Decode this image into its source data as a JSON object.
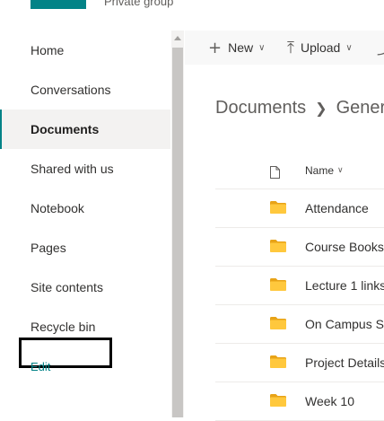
{
  "header": {
    "subtitle": "Private group"
  },
  "colors": {
    "accent": "#038387",
    "folder": "#ffc83d",
    "folder_tab": "#e8a317"
  },
  "sidebar": {
    "items": [
      {
        "label": "Home",
        "selected": false
      },
      {
        "label": "Conversations",
        "selected": false
      },
      {
        "label": "Documents",
        "selected": true
      },
      {
        "label": "Shared with us",
        "selected": false
      },
      {
        "label": "Notebook",
        "selected": false
      },
      {
        "label": "Pages",
        "selected": false
      },
      {
        "label": "Site contents",
        "selected": false
      },
      {
        "label": "Recycle bin",
        "selected": false,
        "highlighted": true
      }
    ],
    "edit_label": "Edit"
  },
  "commandbar": {
    "new": {
      "icon": "plus-icon",
      "label": "New"
    },
    "upload": {
      "icon": "upload-icon",
      "label": "Upload"
    }
  },
  "breadcrumb": {
    "root": "Documents",
    "current": "General"
  },
  "list": {
    "name_header": "Name",
    "rows": [
      {
        "name": "Attendance",
        "type": "folder"
      },
      {
        "name": "Course Books",
        "type": "folder"
      },
      {
        "name": "Lecture 1 links",
        "type": "folder"
      },
      {
        "name": "On Campus St",
        "type": "folder"
      },
      {
        "name": "Project Details",
        "type": "folder"
      },
      {
        "name": "Week 10",
        "type": "folder"
      }
    ]
  }
}
